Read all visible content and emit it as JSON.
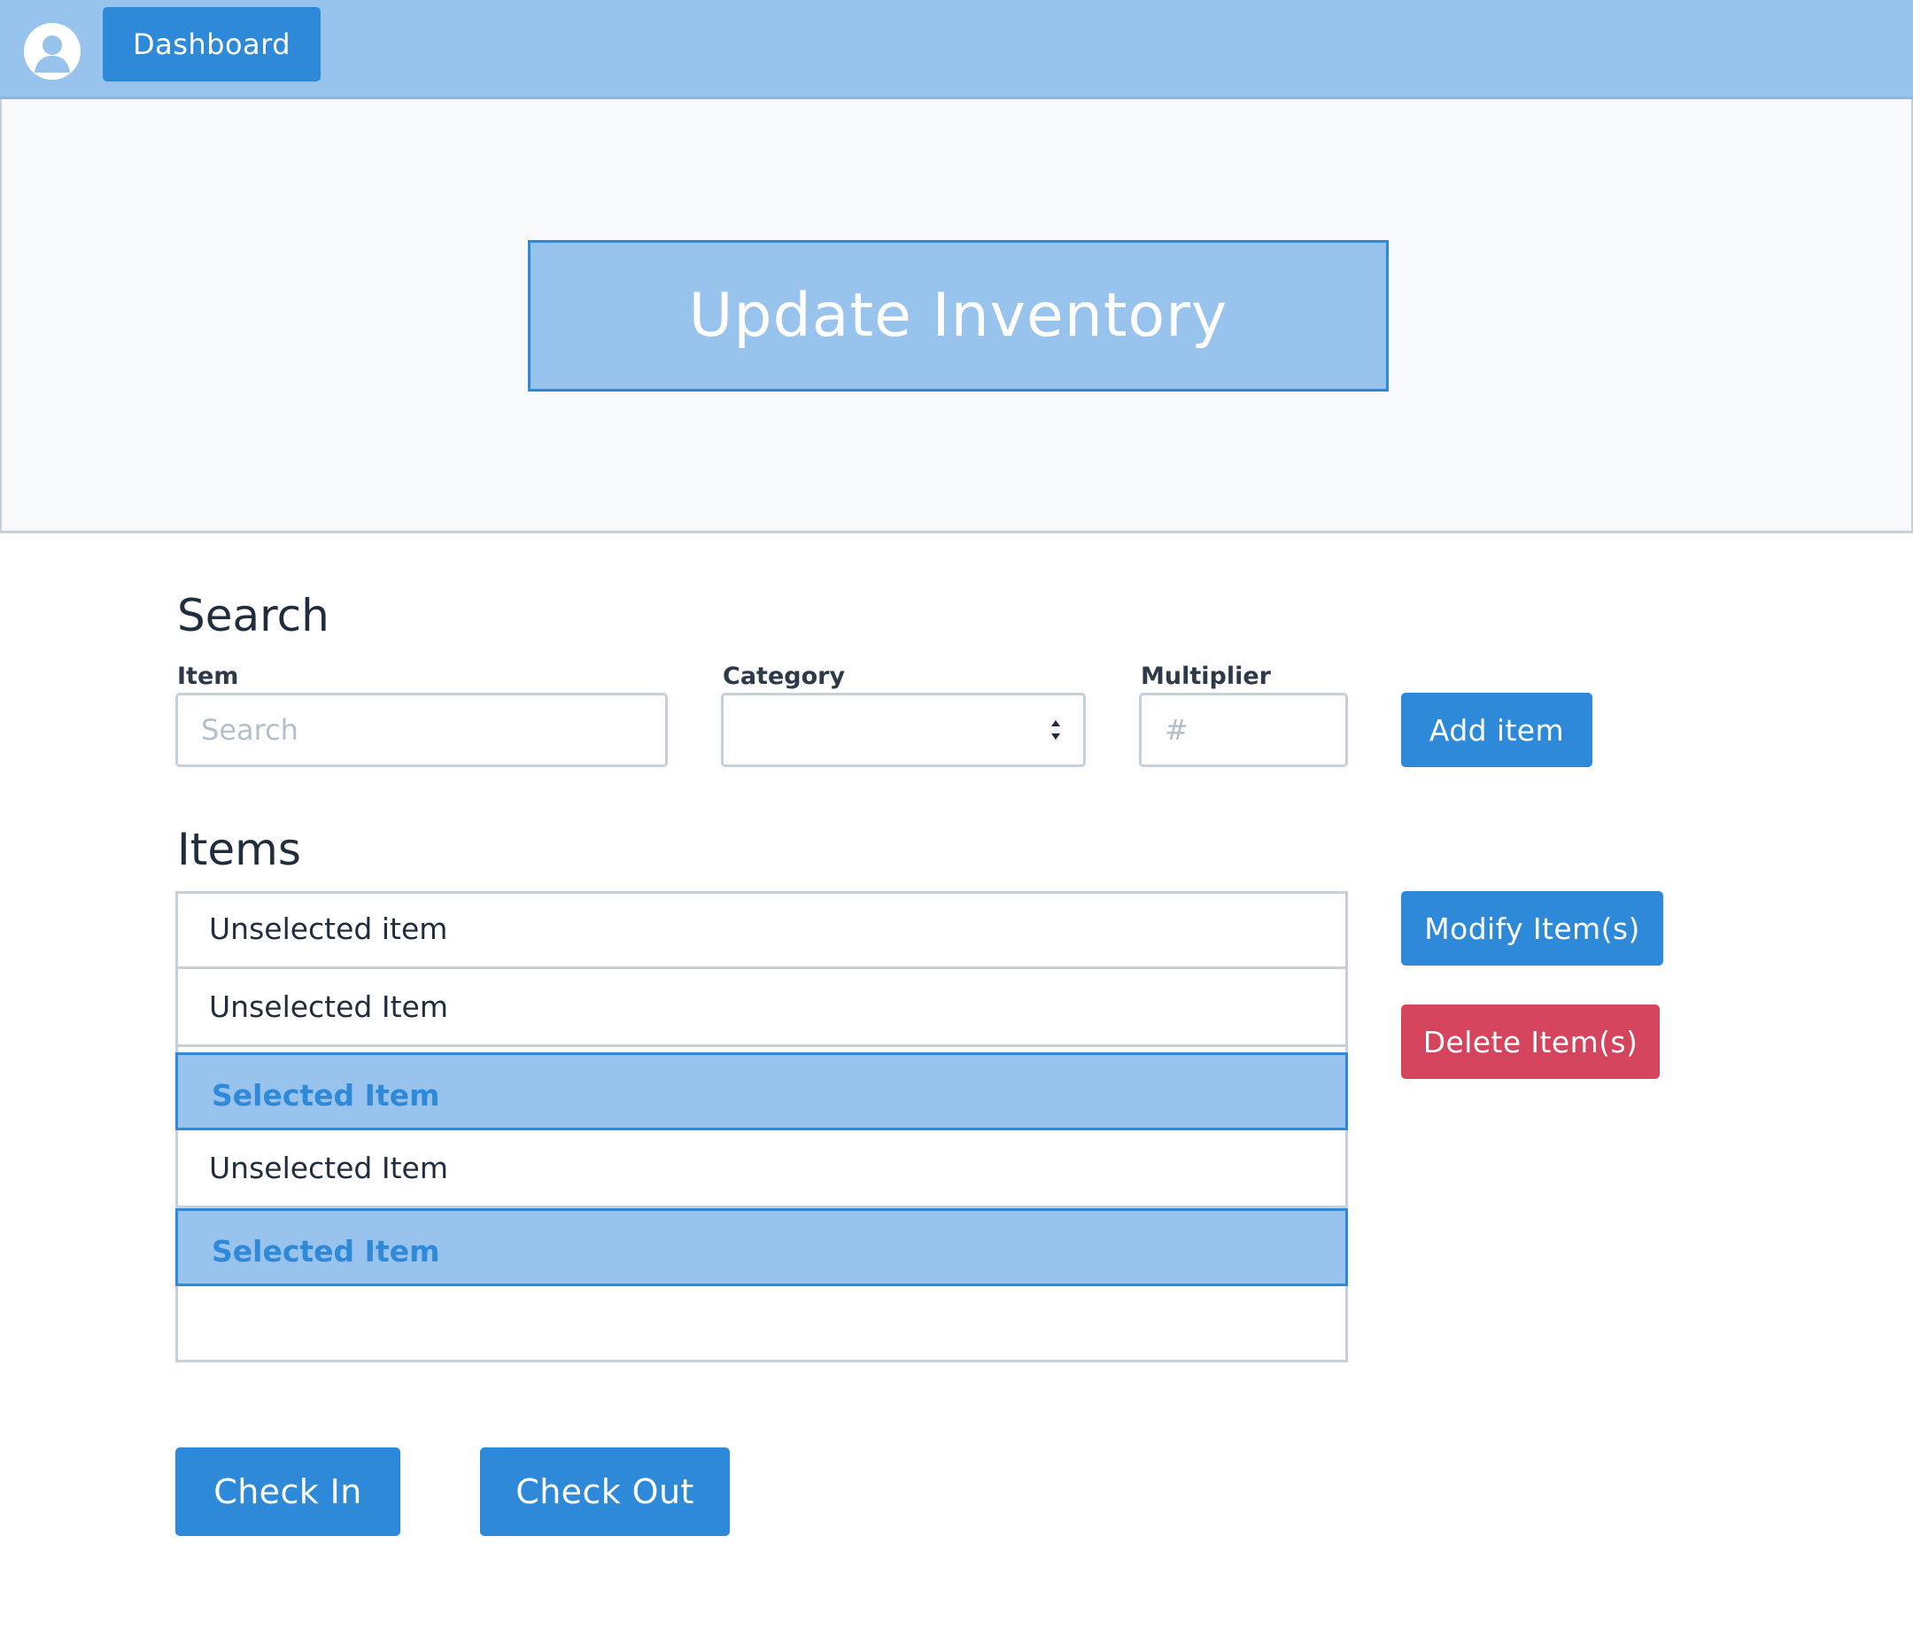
{
  "nav": {
    "avatar_icon": "user-avatar-icon",
    "dashboard_label": "Dashboard"
  },
  "hero": {
    "title": "Update Inventory"
  },
  "search": {
    "heading": "Search",
    "item_label": "Item",
    "item_placeholder": "Search",
    "item_value": "",
    "category_label": "Category",
    "category_value": "",
    "multiplier_label": "Multiplier",
    "multiplier_placeholder": "#",
    "multiplier_value": "",
    "add_button": "Add item"
  },
  "items": {
    "heading": "Items",
    "list": [
      {
        "label": "Unselected item",
        "selected": false
      },
      {
        "label": "Unselected Item",
        "selected": false
      },
      {
        "label": "Selected Item",
        "selected": true
      },
      {
        "label": "Unselected Item",
        "selected": false
      },
      {
        "label": "Selected Item",
        "selected": true
      }
    ],
    "modify_button": "Modify Item(s)",
    "delete_button": "Delete Item(s)"
  },
  "actions": {
    "check_in": "Check In",
    "check_out": "Check Out"
  },
  "colors": {
    "primary": "#2e89d9",
    "light_primary": "#97c3ec",
    "danger": "#d4445c",
    "border": "#c7d0da"
  }
}
